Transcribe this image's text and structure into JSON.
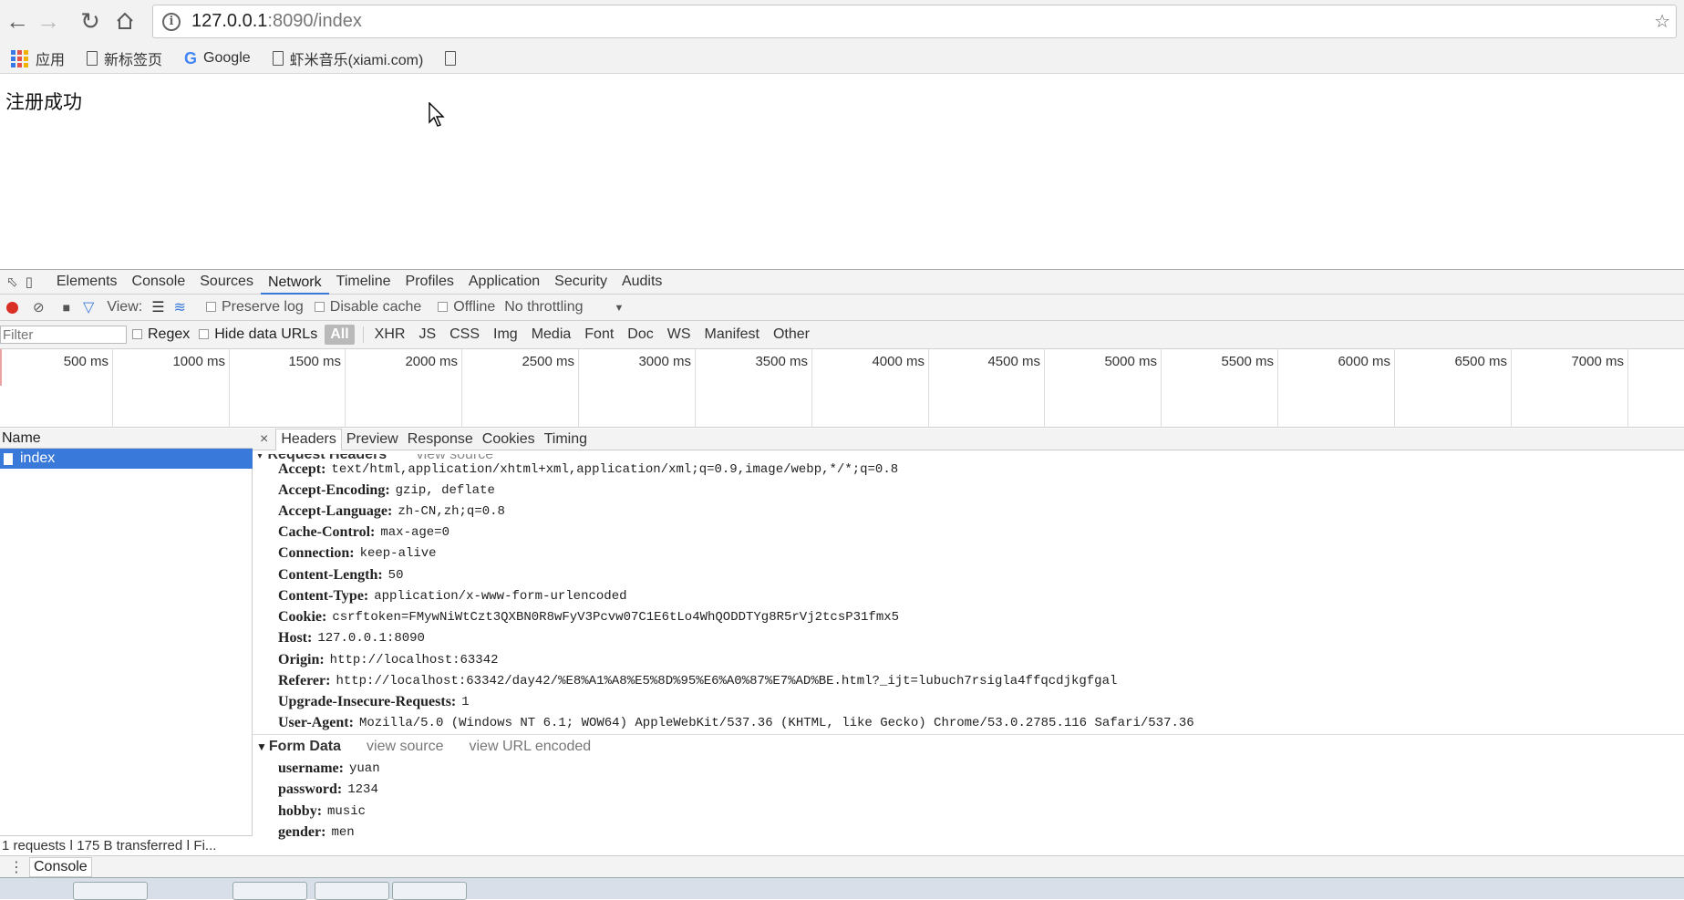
{
  "browser": {
    "url_host": "127.0.0.1",
    "url_rest": ":8090/index",
    "bookmarks": [
      {
        "label": "应用",
        "icon": "apps-grid-icon"
      },
      {
        "label": "新标签页",
        "icon": "page-icon"
      },
      {
        "label": "Google",
        "icon": "google-icon"
      },
      {
        "label": "虾米音乐(xiami.com)",
        "icon": "page-icon"
      },
      {
        "label": "",
        "icon": "page-icon"
      }
    ]
  },
  "page": {
    "message": "注册成功"
  },
  "devtools": {
    "tabs": [
      "Elements",
      "Console",
      "Sources",
      "Network",
      "Timeline",
      "Profiles",
      "Application",
      "Security",
      "Audits"
    ],
    "active_tab": "Network",
    "toolbar": {
      "view_label": "View:",
      "preserve_log": "Preserve log",
      "disable_cache": "Disable cache",
      "offline": "Offline",
      "throttling": "No throttling"
    },
    "filter": {
      "placeholder": "Filter",
      "regex": "Regex",
      "hide_data_urls": "Hide data URLs",
      "types": [
        "All",
        "XHR",
        "JS",
        "CSS",
        "Img",
        "Media",
        "Font",
        "Doc",
        "WS",
        "Manifest",
        "Other"
      ],
      "active_type": "All"
    },
    "timeline_ticks": [
      "500 ms",
      "1000 ms",
      "1500 ms",
      "2000 ms",
      "2500 ms",
      "3000 ms",
      "3500 ms",
      "4000 ms",
      "4500 ms",
      "5000 ms",
      "5500 ms",
      "6000 ms",
      "6500 ms",
      "7000 ms"
    ],
    "requests": {
      "column": "Name",
      "rows": [
        "index"
      ],
      "status": "1 requests ǀ 175 B transferred ǀ Fi..."
    },
    "detail": {
      "close": "×",
      "tabs": [
        "Headers",
        "Preview",
        "Response",
        "Cookies",
        "Timing"
      ],
      "active_tab": "Headers",
      "request_headers_title": "Request Headers",
      "view_source": "view source",
      "view_url_encoded": "view URL encoded",
      "headers": [
        {
          "k": "Accept:",
          "v": "text/html,application/xhtml+xml,application/xml;q=0.9,image/webp,*/*;q=0.8"
        },
        {
          "k": "Accept-Encoding:",
          "v": "gzip, deflate"
        },
        {
          "k": "Accept-Language:",
          "v": "zh-CN,zh;q=0.8"
        },
        {
          "k": "Cache-Control:",
          "v": "max-age=0"
        },
        {
          "k": "Connection:",
          "v": "keep-alive"
        },
        {
          "k": "Content-Length:",
          "v": "50"
        },
        {
          "k": "Content-Type:",
          "v": "application/x-www-form-urlencoded"
        },
        {
          "k": "Cookie:",
          "v": "csrftoken=FMywNiWtCzt3QXBN0R8wFyV3Pcvw07C1E6tLo4WhQODDTYg8R5rVj2tcsP31fmx5"
        },
        {
          "k": "Host:",
          "v": "127.0.0.1:8090"
        },
        {
          "k": "Origin:",
          "v": "http://localhost:63342"
        },
        {
          "k": "Referer:",
          "v": "http://localhost:63342/day42/%E8%A1%A8%E5%8D%95%E6%A0%87%E7%AD%BE.html?_ijt=lubuch7rsigla4ffqcdjkgfgal"
        },
        {
          "k": "Upgrade-Insecure-Requests:",
          "v": "1"
        },
        {
          "k": "User-Agent:",
          "v": "Mozilla/5.0 (Windows NT 6.1; WOW64) AppleWebKit/537.36 (KHTML, like Gecko) Chrome/53.0.2785.116 Safari/537.36"
        }
      ],
      "form_data_title": "Form Data",
      "form_data": [
        {
          "k": "username:",
          "v": "yuan"
        },
        {
          "k": "password:",
          "v": "1234"
        },
        {
          "k": "hobby:",
          "v": "music"
        },
        {
          "k": "gender:",
          "v": "men"
        }
      ]
    },
    "drawer_tab": "Console"
  }
}
